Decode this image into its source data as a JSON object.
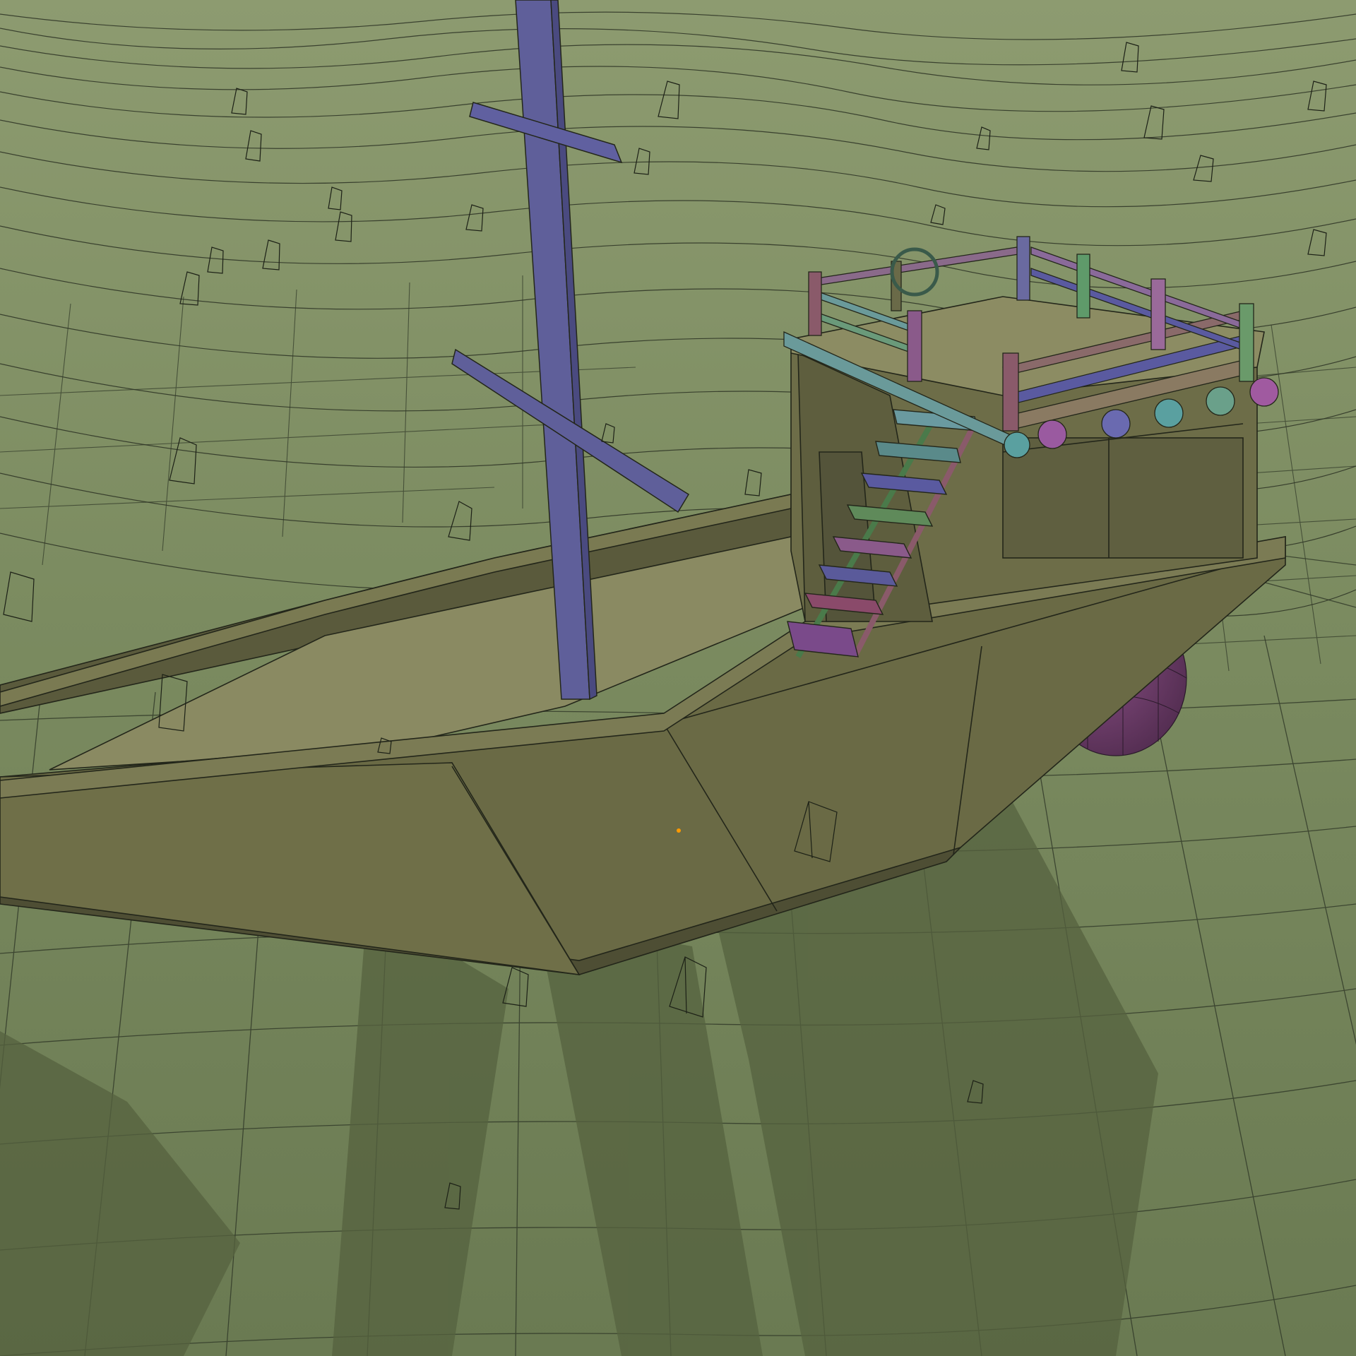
{
  "viewport": {
    "shading": "solid",
    "overlay": "wireframe",
    "colors": {
      "ground": "#6e7e58",
      "ground_far": "#8a9a6e",
      "wire": "#2a2f22",
      "hull": "#6a6a45",
      "hull_dark": "#55553a",
      "deck": "#8a8a62",
      "cabin": "#6d6d48",
      "mast": "#5f5f9a",
      "shadow": "#55623f",
      "sphere": "#6e3f6a",
      "origin_dot": "#ff9a00"
    },
    "objects": [
      {
        "name": "ocean-mesh",
        "icon": "grid-mesh"
      },
      {
        "name": "ship-hull",
        "icon": "mesh"
      },
      {
        "name": "ship-mast",
        "icon": "mesh"
      },
      {
        "name": "stern-cabin",
        "icon": "mesh"
      },
      {
        "name": "ship-stairs",
        "icon": "mesh"
      },
      {
        "name": "ship-wheel",
        "icon": "mesh"
      },
      {
        "name": "hull-sphere",
        "icon": "mesh"
      },
      {
        "name": "buoy-markers",
        "icon": "cone-wire"
      }
    ]
  }
}
